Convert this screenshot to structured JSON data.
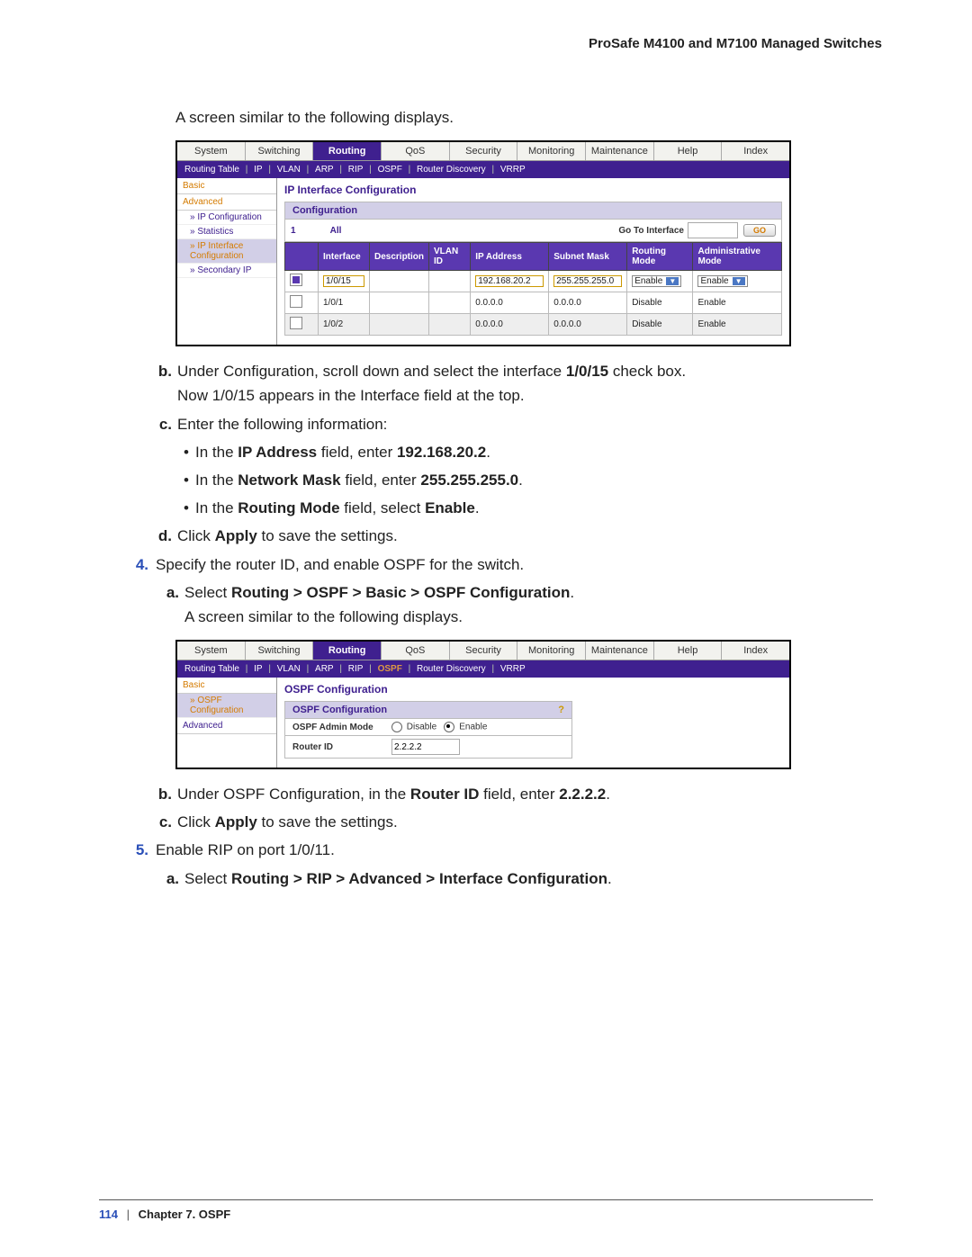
{
  "header": {
    "title": "ProSafe M4100 and M7100 Managed Switches"
  },
  "intro1": "A screen similar to the following displays.",
  "screenshot1": {
    "tabs": [
      "System",
      "Switching",
      "Routing",
      "QoS",
      "Security",
      "Monitoring",
      "Maintenance",
      "Help",
      "Index"
    ],
    "active_tab": "Routing",
    "subtabs_prefix": [
      "Routing Table",
      "IP",
      "VLAN",
      "ARP",
      "RIP",
      "OSPF",
      "Router Discovery",
      "VRRP"
    ],
    "sidebar": {
      "basic": "Basic",
      "advanced": "Advanced",
      "items": [
        "IP Configuration",
        "Statistics",
        "IP Interface Configuration",
        "Secondary IP"
      ]
    },
    "section_title": "IP Interface Configuration",
    "conf_heading": "Configuration",
    "filter": {
      "one": "1",
      "all": "All",
      "goto_label": "Go To Interface",
      "go": "GO"
    },
    "columns": [
      "",
      "Interface",
      "Description",
      "VLAN ID",
      "IP Address",
      "Subnet Mask",
      "Routing Mode",
      "Administrative Mode"
    ],
    "rows": [
      {
        "checked": true,
        "iface": "1/0/15",
        "desc": "",
        "vlan": "",
        "ip": "192.168.20.2",
        "mask": "255.255.255.0",
        "rmode": "Enable",
        "amode": "Enable",
        "editable": true
      },
      {
        "checked": false,
        "iface": "1/0/1",
        "desc": "",
        "vlan": "",
        "ip": "0.0.0.0",
        "mask": "0.0.0.0",
        "rmode": "Disable",
        "amode": "Enable"
      },
      {
        "checked": false,
        "iface": "1/0/2",
        "desc": "",
        "vlan": "",
        "ip": "0.0.0.0",
        "mask": "0.0.0.0",
        "rmode": "Disable",
        "amode": "Enable",
        "alt": true
      }
    ]
  },
  "step_b": {
    "pre": "Under Configuration, scroll down and select the interface ",
    "bold": "1/0/15",
    "post": " check box.",
    "line2": "Now 1/0/15 appears in the Interface field at the top."
  },
  "step_c": {
    "intro": "Enter the following information:",
    "b1_pre": "In the ",
    "b1_bold1": "IP Address",
    "b1_mid": " field, enter ",
    "b1_bold2": "192.168.20.2",
    "b1_post": ".",
    "b2_pre": "In the ",
    "b2_bold1": "Network Mask",
    "b2_mid": " field, enter ",
    "b2_bold2": "255.255.255.0",
    "b2_post": ".",
    "b3_pre": "In the ",
    "b3_bold1": "Routing Mode",
    "b3_mid": " field, select ",
    "b3_bold2": "Enable",
    "b3_post": "."
  },
  "step_d": {
    "pre": "Click ",
    "bold": "Apply",
    "post": " to save the settings."
  },
  "step4": {
    "text": "Specify the router ID, and enable OSPF for the switch.",
    "a_pre": "Select ",
    "a_bold": "Routing > OSPF > Basic > OSPF Configuration",
    "a_post": ".",
    "line2": "A screen similar to the following displays."
  },
  "screenshot2": {
    "tabs": [
      "System",
      "Switching",
      "Routing",
      "QoS",
      "Security",
      "Monitoring",
      "Maintenance",
      "Help",
      "Index"
    ],
    "active_tab": "Routing",
    "subtabs": [
      "Routing Table",
      "IP",
      "VLAN",
      "ARP",
      "RIP",
      "OSPF",
      "Router Discovery",
      "VRRP"
    ],
    "subtab_sel": "OSPF",
    "sidebar": {
      "basic": "Basic",
      "item": "OSPF Configuration",
      "advanced": "Advanced"
    },
    "section_title": "OSPF Configuration",
    "panel_header": "OSPF Configuration",
    "help": "?",
    "admin_label": "OSPF Admin Mode",
    "admin_disable": "Disable",
    "admin_enable": "Enable",
    "routerid_label": "Router ID",
    "routerid_value": "2.2.2.2"
  },
  "step4b": {
    "pre": "Under OSPF Configuration, in the ",
    "bold1": "Router ID",
    "mid": " field, enter ",
    "bold2": "2.2.2.2",
    "post": "."
  },
  "step4c": {
    "pre": "Click ",
    "bold": "Apply",
    "post": " to save the settings."
  },
  "step5": {
    "text": "Enable RIP on port 1/0/11.",
    "a_pre": "Select ",
    "a_bold": "Routing > RIP > Advanced > Interface Configuration",
    "a_post": "."
  },
  "footer": {
    "page": "114",
    "sep": "|",
    "chapter": "Chapter 7.  OSPF"
  }
}
